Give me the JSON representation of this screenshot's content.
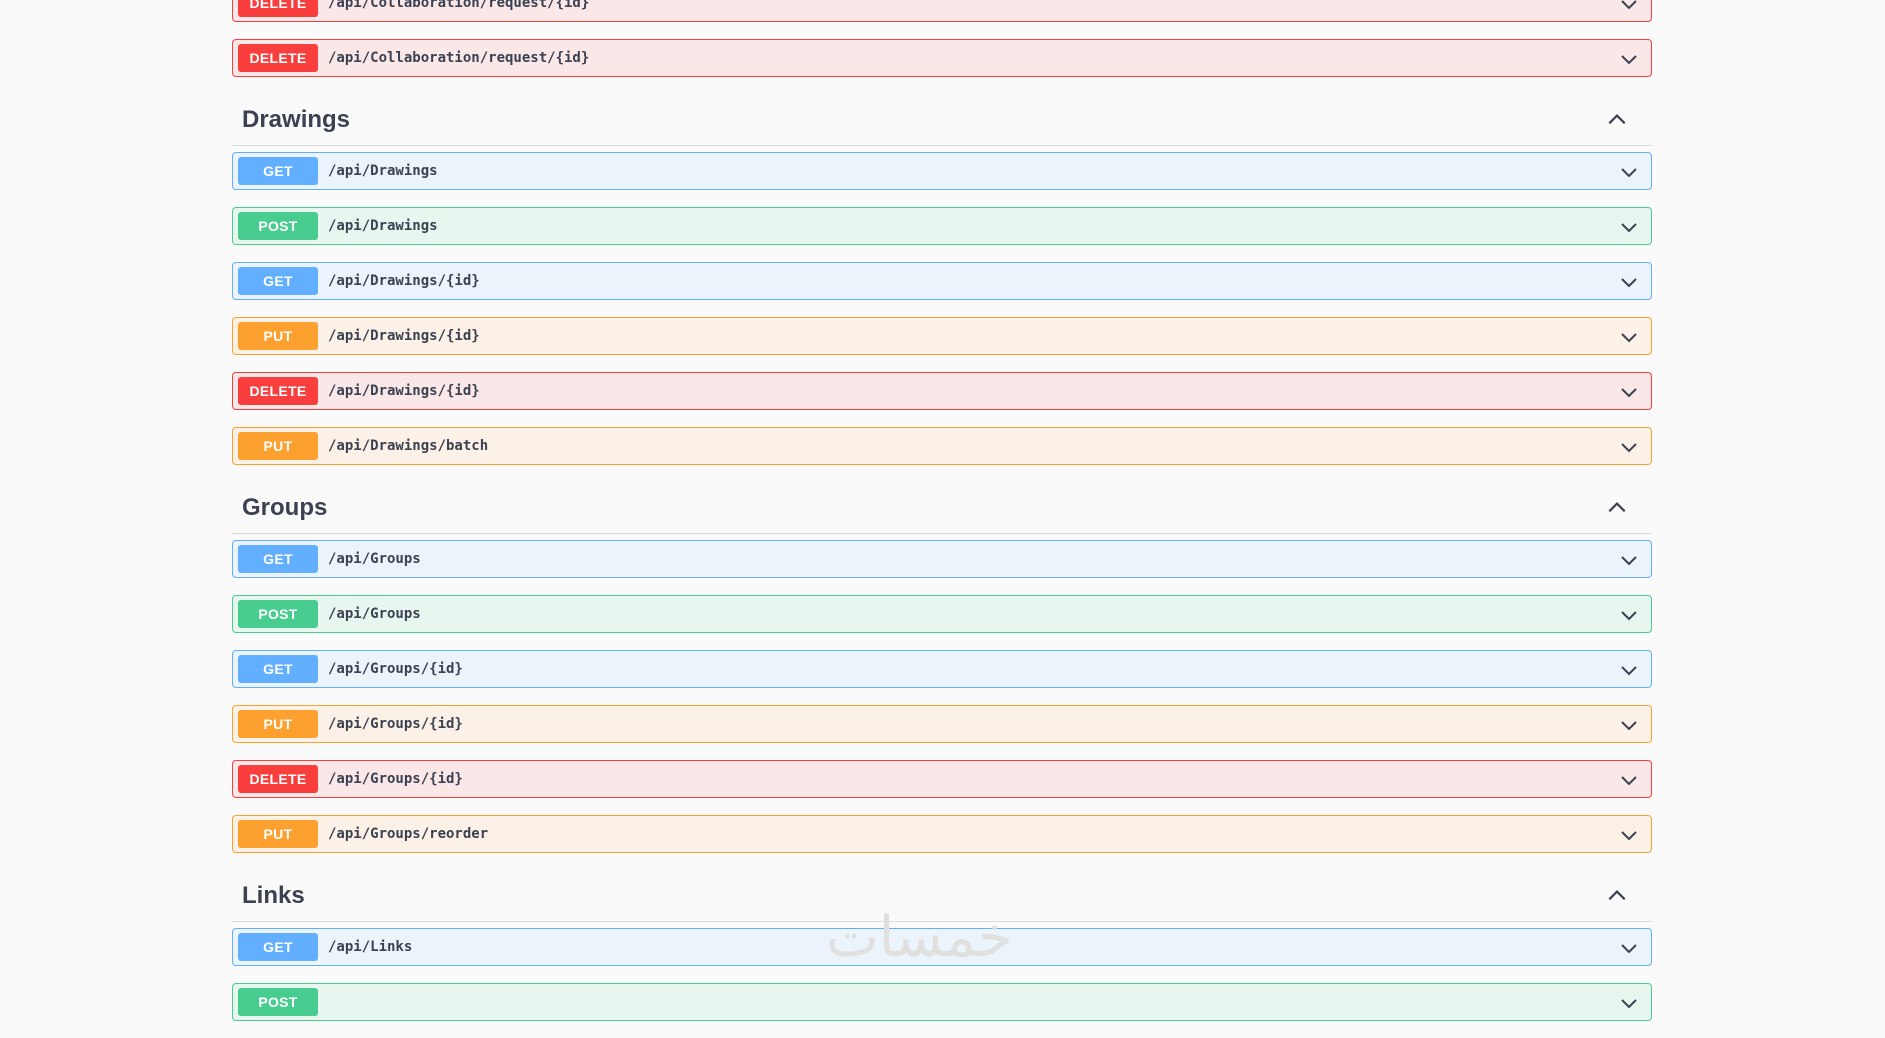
{
  "sections": [
    {
      "title": "",
      "ops": [
        {
          "method": "DELETE",
          "path": "/api/Collaboration/request/{id}"
        },
        {
          "method": "DELETE",
          "path": "/api/Collaboration/request/{id}"
        }
      ]
    },
    {
      "title": "Drawings",
      "ops": [
        {
          "method": "GET",
          "path": "/api/Drawings"
        },
        {
          "method": "POST",
          "path": "/api/Drawings"
        },
        {
          "method": "GET",
          "path": "/api/Drawings/{id}"
        },
        {
          "method": "PUT",
          "path": "/api/Drawings/{id}"
        },
        {
          "method": "DELETE",
          "path": "/api/Drawings/{id}"
        },
        {
          "method": "PUT",
          "path": "/api/Drawings/batch"
        }
      ]
    },
    {
      "title": "Groups",
      "ops": [
        {
          "method": "GET",
          "path": "/api/Groups"
        },
        {
          "method": "POST",
          "path": "/api/Groups"
        },
        {
          "method": "GET",
          "path": "/api/Groups/{id}"
        },
        {
          "method": "PUT",
          "path": "/api/Groups/{id}"
        },
        {
          "method": "DELETE",
          "path": "/api/Groups/{id}"
        },
        {
          "method": "PUT",
          "path": "/api/Groups/reorder"
        }
      ]
    },
    {
      "title": "Links",
      "ops": [
        {
          "method": "GET",
          "path": "/api/Links"
        },
        {
          "method": "POST",
          "path": ""
        }
      ]
    }
  ],
  "colors": {
    "get": "#61affe",
    "post": "#49cc90",
    "put": "#fca130",
    "delete": "#f93e3e"
  },
  "watermark": "خمسات",
  "icons": {
    "expand": "chevron-down-icon",
    "collapse": "chevron-up-icon"
  }
}
